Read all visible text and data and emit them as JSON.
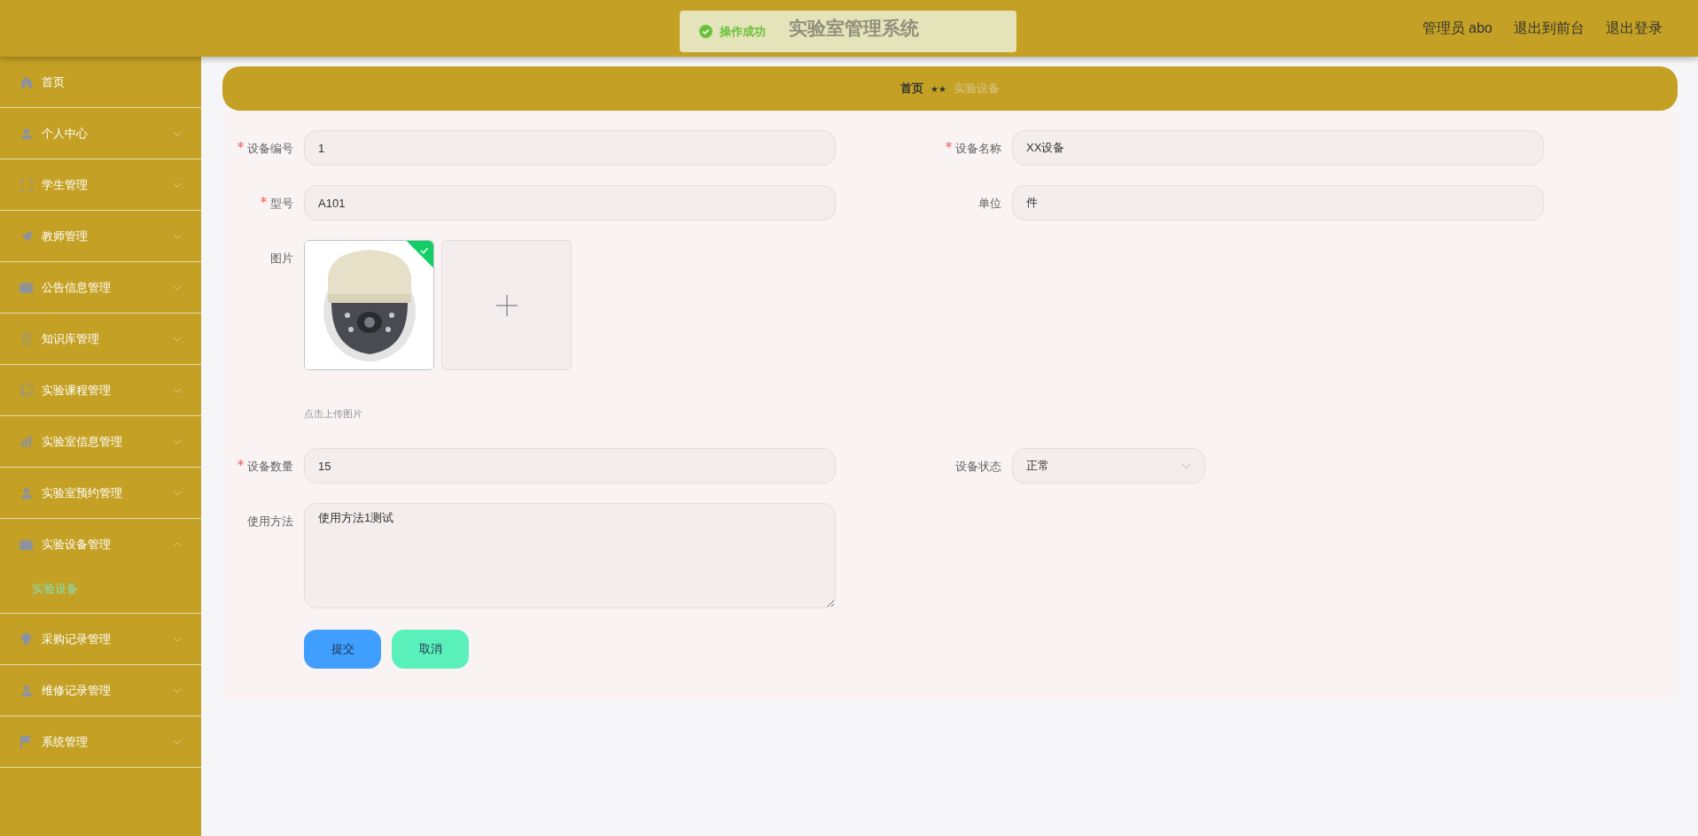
{
  "header": {
    "title": "实验室管理系统",
    "user": "管理员 abo",
    "links": [
      "退出到前台",
      "退出登录"
    ]
  },
  "toast": {
    "kind": "success",
    "message": "操作成功"
  },
  "sidebar": {
    "items": [
      {
        "kind": "link",
        "label": "首页"
      },
      {
        "kind": "menu",
        "label": "个人中心",
        "expanded": false
      },
      {
        "kind": "menu",
        "label": "学生管理",
        "expanded": false
      },
      {
        "kind": "menu",
        "label": "教师管理",
        "expanded": false
      },
      {
        "kind": "menu",
        "label": "公告信息管理",
        "expanded": false
      },
      {
        "kind": "menu",
        "label": "知识库管理",
        "expanded": false
      },
      {
        "kind": "menu",
        "label": "实验课程管理",
        "expanded": false
      },
      {
        "kind": "menu",
        "label": "实验室信息管理",
        "expanded": false
      },
      {
        "kind": "menu",
        "label": "实验室预约管理",
        "expanded": false
      },
      {
        "kind": "menu",
        "label": "实验设备管理",
        "expanded": true,
        "children": [
          {
            "label": "实验设备",
            "selected": true
          }
        ]
      },
      {
        "kind": "menu",
        "label": "采购记录管理",
        "expanded": false
      },
      {
        "kind": "menu",
        "label": "维修记录管理",
        "expanded": false
      },
      {
        "kind": "menu",
        "label": "系统管理",
        "expanded": false
      }
    ]
  },
  "breadcrumb": {
    "items": [
      "首页",
      "实验设备"
    ],
    "separator": "★★"
  },
  "form": {
    "rows": [
      [
        {
          "kind": "text",
          "label": "设备编号",
          "required": true,
          "value": "1"
        },
        {
          "kind": "text",
          "label": "设备名称",
          "required": true,
          "value": "XX设备"
        }
      ],
      [
        {
          "kind": "text",
          "label": "型号",
          "required": true,
          "value": "A101"
        },
        {
          "kind": "text",
          "label": "单位",
          "required": false,
          "value": "件"
        }
      ],
      [
        {
          "kind": "upload",
          "label": "图片",
          "required": false,
          "images": [
            {
              "kind": "picture",
              "uploaded": true
            }
          ],
          "hint": "点击上传图片"
        }
      ],
      [
        {
          "kind": "text",
          "label": "设备数量",
          "required": true,
          "value": "15"
        },
        {
          "kind": "select",
          "label": "设备状态",
          "required": false,
          "value": "正常"
        }
      ],
      [
        {
          "kind": "textarea",
          "label": "使用方法",
          "required": false,
          "value": "使用方法1测试"
        }
      ]
    ],
    "buttons": [
      {
        "kind": "primary",
        "label": "提交"
      },
      {
        "kind": "secondary",
        "label": "取消"
      }
    ]
  }
}
